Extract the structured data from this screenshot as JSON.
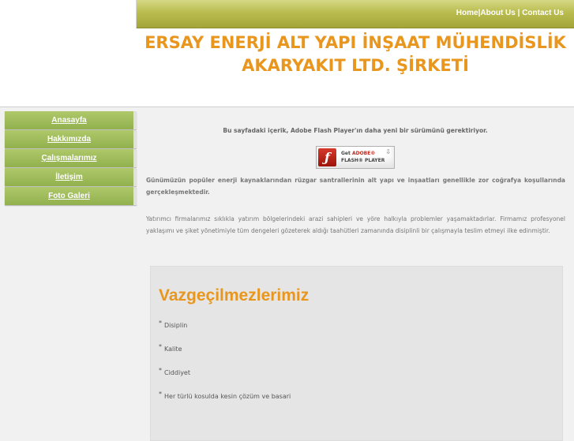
{
  "topnav": {
    "home": "Home",
    "sep1": "|",
    "about": "About Us",
    "sep2": " | ",
    "contact": "Contact Us"
  },
  "header": {
    "title_line1": "ERSAY ENERJİ ALT YAPI İNŞAAT MÜHENDİSLİK",
    "title_line2": "AKARYAKIT LTD. ŞİRKETİ"
  },
  "sidebar": {
    "items": [
      {
        "label": "Anasayfa"
      },
      {
        "label": "Hakkımızda"
      },
      {
        "label": "Çalışmalarımız"
      },
      {
        "label": "İletişim"
      },
      {
        "label": "Foto Galeri"
      }
    ]
  },
  "content": {
    "flash_notice": "Bu sayfadaki içerik, Adobe Flash Player'ın daha yeni bir sürümünü gerektiriyor.",
    "flash_badge": {
      "get": "Get ",
      "adobe": "ADOBE®",
      "product": "FLASH® PLAYER",
      "logo_icon": "flash-logo-icon",
      "download_icon": "download-arrow-icon"
    },
    "paragraph1": "Günümüzün popüler enerji kaynaklarından rüzgar santrallerinin alt yapı ve inşaatları genellikle zor coğrafya koşullarında gerçekleşmektedir.",
    "paragraph2": "Yatırımcı firmalarımız sıklıkla yatırım bölgelerindeki arazi sahipleri ve yöre halkıyla problemler yaşamaktadırlar. Firmamız profesyonel yaklaşımı ve şiket yönetimiyle tüm dengeleri gözeterek aldığı taahütleri zamanında disiplinli bir çalışmayla teslim etmeyi ilke edinmiştir."
  },
  "values_box": {
    "title": "Vazgeçilmezlerimiz",
    "bullet_char": "*",
    "items": [
      "Disiplin",
      "Kalite",
      "Ciddiyet",
      "Her türlü kosulda kesin çözüm ve basari"
    ]
  },
  "colors": {
    "accent_orange": "#e9961e",
    "menu_green": "#9cb85a",
    "topbar_olive": "#b9bc4e"
  }
}
